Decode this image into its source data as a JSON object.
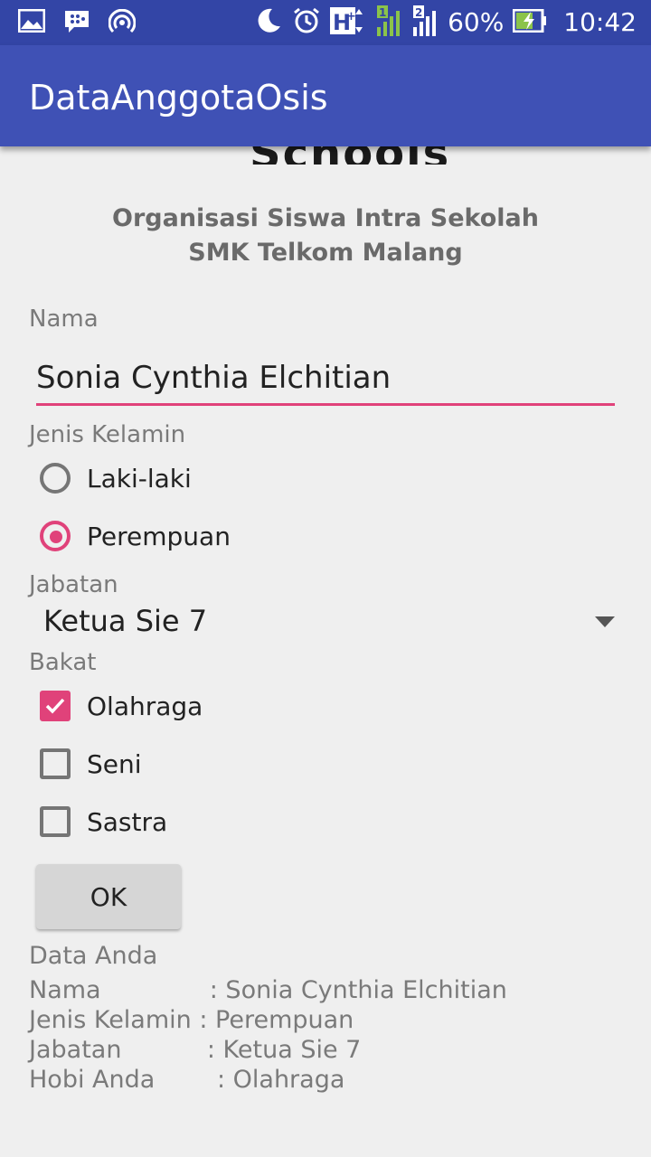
{
  "status_bar": {
    "battery": "60%",
    "time": "10:42",
    "icons_left": [
      "gallery-icon",
      "bbm-icon",
      "hotspot-icon"
    ],
    "icons_right": [
      "moon-icon",
      "alarm-icon",
      "hplus-icon",
      "signal1-icon",
      "signal2-icon",
      "battery-icon"
    ]
  },
  "app_bar": {
    "title": "DataAnggotaOsis"
  },
  "logo": {
    "text": "Schools"
  },
  "org": {
    "line1": "Organisasi Siswa Intra Sekolah",
    "line2": "SMK Telkom Malang"
  },
  "form": {
    "nama_label": "Nama",
    "nama_value": "Sonia Cynthia Elchitian",
    "gender_label": "Jenis Kelamin",
    "gender_options": [
      {
        "label": "Laki-laki",
        "checked": false
      },
      {
        "label": "Perempuan",
        "checked": true
      }
    ],
    "jabatan_label": "Jabatan",
    "jabatan_value": "Ketua Sie 7",
    "bakat_label": "Bakat",
    "bakat_options": [
      {
        "label": "Olahraga",
        "checked": true
      },
      {
        "label": "Seni",
        "checked": false
      },
      {
        "label": "Sastra",
        "checked": false
      }
    ],
    "ok_label": "OK"
  },
  "summary": {
    "title": "Data Anda",
    "lines": [
      "Nama              : Sonia Cynthia Elchitian",
      "Jenis Kelamin : Perempuan",
      "Jabatan           : Ketua Sie 7",
      "Hobi Anda        : Olahraga"
    ]
  },
  "colors": {
    "accent": "#e0427a",
    "primary": "#3f51b5",
    "primary_dark": "#3345a6"
  }
}
